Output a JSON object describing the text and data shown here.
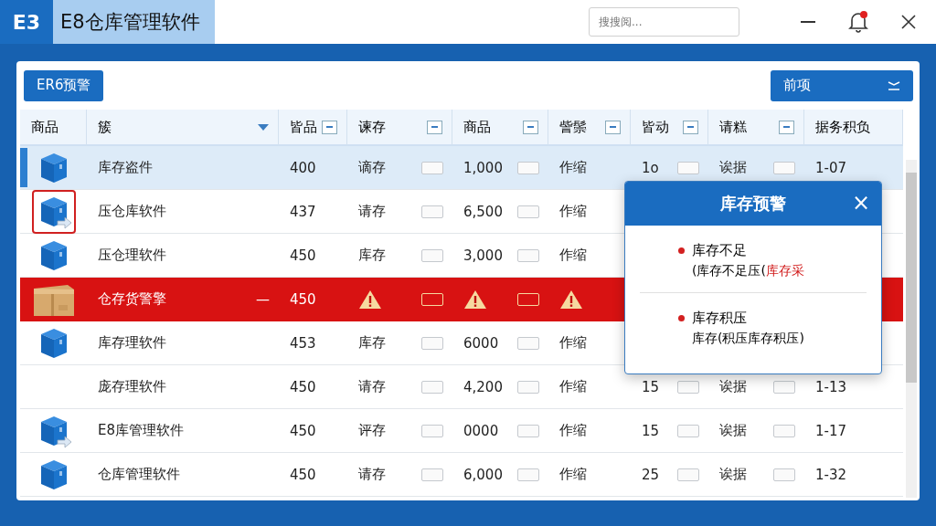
{
  "window": {
    "logo": "E3",
    "title": "E8仓库管理软件"
  },
  "search": {
    "placeholder": "搜搜阅..."
  },
  "notifications": {
    "unread": true
  },
  "toolbar": {
    "left_button": "ER6预警",
    "right_button": "前项"
  },
  "table": {
    "columns": [
      {
        "label": "商品",
        "kind": "plain"
      },
      {
        "label": "簇",
        "kind": "sort"
      },
      {
        "label": "皆品",
        "kind": "filter"
      },
      {
        "label": "谏存",
        "kind": "filter"
      },
      {
        "label": "商品",
        "kind": "filter"
      },
      {
        "label": "訾鬃",
        "kind": "filter"
      },
      {
        "label": "皆动",
        "kind": "filter"
      },
      {
        "label": "请糕",
        "kind": "filter"
      },
      {
        "label": "据务积负",
        "kind": "plain"
      }
    ],
    "rows": [
      {
        "kind": "normal",
        "selected": true,
        "flagged": false,
        "cells": [
          "",
          "库存盗件",
          "400",
          "谪存",
          "1,000",
          "作缩",
          "1o",
          "诶据",
          "1-07"
        ]
      },
      {
        "kind": "normal",
        "selected": false,
        "flagged": true,
        "cells": [
          "",
          "压仓库软件",
          "437",
          "请存",
          "6,500",
          "作缩"
        ]
      },
      {
        "kind": "normal",
        "selected": false,
        "flagged": false,
        "cells": [
          "",
          "压仓理软件",
          "450",
          "库存",
          "3,000",
          "作缩"
        ]
      },
      {
        "kind": "alert",
        "selected": false,
        "flagged": false,
        "mark": "—",
        "cells": [
          "",
          "仓存货警擎",
          "450"
        ]
      },
      {
        "kind": "normal",
        "selected": false,
        "flagged": false,
        "cells": [
          "",
          "库存理软件",
          "453",
          "库存",
          "6000",
          "作缩"
        ]
      },
      {
        "kind": "normal",
        "selected": false,
        "flagged": false,
        "cells": [
          "",
          "庞存理软件",
          "450",
          "请存",
          "4,200",
          "作缩",
          "15",
          "诶据",
          "1-13"
        ]
      },
      {
        "kind": "normal",
        "selected": false,
        "flagged": false,
        "cells": [
          "",
          "E8库管理软件",
          "450",
          "评存",
          "0000",
          "作缩",
          "15",
          "诶据",
          "1-17"
        ]
      },
      {
        "kind": "normal",
        "selected": false,
        "flagged": false,
        "cells": [
          "",
          "仓库管理软件",
          "450",
          "请存",
          "6,000",
          "作缩",
          "25",
          "诶据",
          "1-32"
        ]
      }
    ]
  },
  "popup": {
    "title": "库存预警",
    "close": "×",
    "items": [
      {
        "title": "库存不足",
        "color": "#d32020",
        "detail": "(库存不足压(",
        "highlight": "库存采"
      },
      {
        "title": "库存积压",
        "color": "#d32020",
        "detail": "库存(积压库存积压)"
      }
    ]
  }
}
